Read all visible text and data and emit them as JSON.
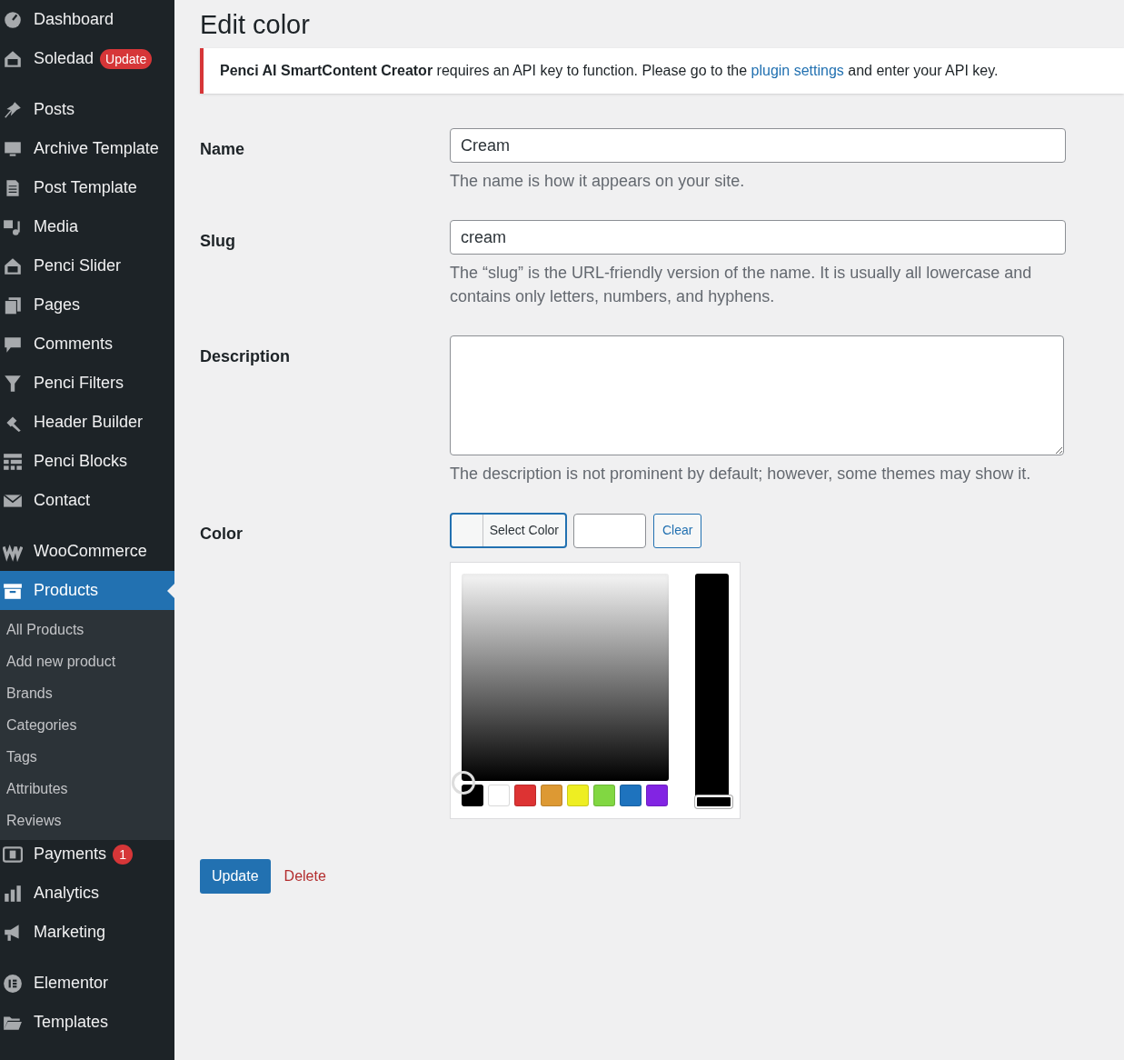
{
  "sidebar": {
    "groups": [
      [
        {
          "label": "Dashboard",
          "selected": false
        },
        {
          "label": "Soledad",
          "badge": "Update",
          "selected": false
        }
      ],
      [
        {
          "label": "Posts",
          "selected": false
        },
        {
          "label": "Archive Template",
          "selected": false
        },
        {
          "label": "Post Template",
          "selected": false
        },
        {
          "label": "Media",
          "selected": false
        },
        {
          "label": "Penci Slider",
          "selected": false
        },
        {
          "label": "Pages",
          "selected": false
        },
        {
          "label": "Comments",
          "selected": false
        },
        {
          "label": "Penci Filters",
          "selected": false
        },
        {
          "label": "Header Builder",
          "selected": false
        },
        {
          "label": "Penci Blocks",
          "selected": false
        },
        {
          "label": "Contact",
          "selected": false
        }
      ],
      [
        {
          "label": "WooCommerce",
          "selected": false
        },
        {
          "label": "Products",
          "selected": true,
          "children": [
            {
              "label": "All Products",
              "selected": false
            },
            {
              "label": "Add new product",
              "selected": false
            },
            {
              "label": "Brands",
              "selected": false
            },
            {
              "label": "Categories",
              "selected": false
            },
            {
              "label": "Tags",
              "selected": false
            },
            {
              "label": "Attributes",
              "selected": false
            },
            {
              "label": "Reviews",
              "selected": false
            }
          ]
        },
        {
          "label": "Payments",
          "badge": "1",
          "selected": false
        },
        {
          "label": "Analytics",
          "selected": false
        },
        {
          "label": "Marketing",
          "selected": false
        }
      ],
      [
        {
          "label": "Elementor",
          "selected": false
        },
        {
          "label": "Templates",
          "selected": false
        }
      ]
    ]
  },
  "page": {
    "title": "Edit color",
    "notice": "**Penci AI SmartContent Creator** requires an API key to function. Please go to the",
    "notice_link": "plugin settings",
    "notice_end": "and enter your API key.",
    "fields": [
      {
        "kind": "input",
        "label": "Name",
        "value": "Cream",
        "help": "The name is how it appears on your site."
      },
      {
        "kind": "input",
        "label": "Slug",
        "value": "cream",
        "help": "The “slug” is the URL-friendly version of the name. It is usually all lowercase and contains only letters, numbers, and hyphens."
      },
      {
        "kind": "textarea",
        "label": "Description",
        "help": "The description is not prominent by default; however, some themes may show it."
      },
      {
        "kind": "color",
        "label": "Color",
        "button": "Select Color",
        "clear": "Clear"
      }
    ],
    "picker": {
      "strip": {
        "level": 0
      },
      "swatches": [
        {
          "color": "#000000"
        },
        {
          "color": "#ffffff"
        },
        {
          "color": "#dd3333"
        },
        {
          "color": "#dd9933"
        },
        {
          "color": "#eeee22"
        },
        {
          "color": "#81d742"
        },
        {
          "color": "#1e73be"
        },
        {
          "color": "#8224e3"
        }
      ]
    },
    "update": "Update",
    "delete": "Delete"
  }
}
